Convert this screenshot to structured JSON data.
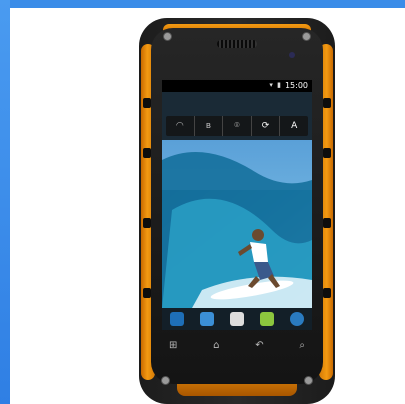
{
  "status_bar": {
    "time": "15:00",
    "icons": "▾ ▮"
  },
  "quick_settings": [
    {
      "name": "wifi-toggle",
      "glyph": "◠"
    },
    {
      "name": "bluetooth-toggle",
      "glyph": "ʙ"
    },
    {
      "name": "gps-toggle",
      "glyph": "⌾"
    },
    {
      "name": "sync-toggle",
      "glyph": "⟳"
    },
    {
      "name": "auto-brightness-toggle",
      "glyph": "A"
    }
  ],
  "dock_icons": [
    "phone-icon",
    "contacts-icon",
    "apps-icon",
    "android-icon",
    "browser-icon"
  ],
  "soft_keys": [
    {
      "name": "menu-key",
      "glyph": "⊞"
    },
    {
      "name": "home-key",
      "glyph": "⌂"
    },
    {
      "name": "back-key",
      "glyph": "↶"
    },
    {
      "name": "search-key",
      "glyph": "⌕"
    }
  ],
  "colors": {
    "accent_orange": "#f39a12",
    "body_black": "#1c1c1c",
    "page_border_blue": "#3a8ce8"
  }
}
